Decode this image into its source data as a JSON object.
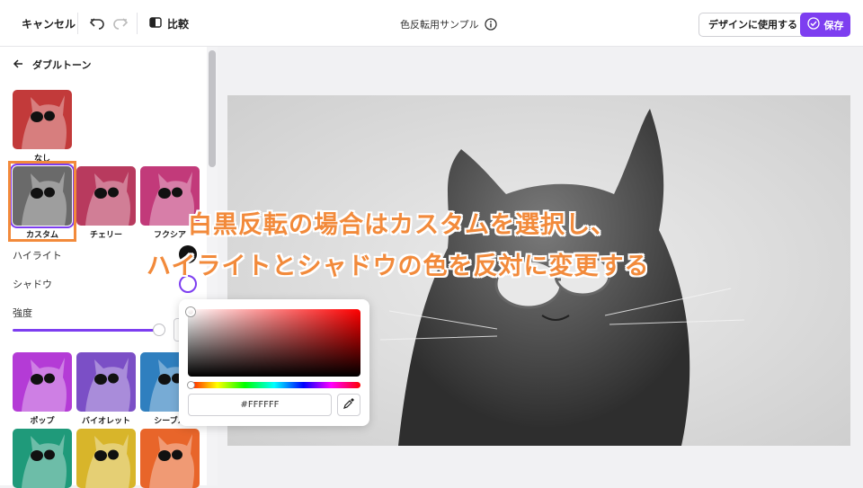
{
  "toolbar": {
    "cancel_label": "キャンセル",
    "undo_icon": "undo-icon",
    "redo_icon": "redo-icon",
    "compare_label": "比較",
    "compare_icon": "compare-icon",
    "doc_title": "色反転用サンプル",
    "info_icon": "info-icon",
    "use_in_design_label": "デザインに使用する",
    "save_label": "保存",
    "save_icon": "check-circle-icon",
    "accent_color": "#7d3ef0"
  },
  "sidebar": {
    "back_icon": "arrow-left-icon",
    "section_title": "ダブルトーン",
    "presets": [
      {
        "label": "なし",
        "tint": "#c23a3a"
      },
      {
        "label": "カスタム",
        "tint": "#6a6a6a",
        "selected": true
      },
      {
        "label": "チェリー",
        "tint": "#b83a5e"
      },
      {
        "label": "フクシア",
        "tint": "#c23a7a"
      },
      {
        "label": "ポップ",
        "tint": "#b43bd6"
      },
      {
        "label": "バイオレット",
        "tint": "#7b4fc6"
      },
      {
        "label": "シーブル",
        "tint": "#2f7fbf"
      },
      {
        "label": "",
        "tint": "#1f9a7a"
      },
      {
        "label": "",
        "tint": "#d8b52a"
      },
      {
        "label": "",
        "tint": "#e8652a"
      }
    ],
    "highlight_label": "ハイライト",
    "shadow_label": "シャドウ",
    "highlight_color": "#111111",
    "shadow_color": "#7d3ef0",
    "intensity_label": "強度",
    "intensity_value": 0.97
  },
  "color_picker": {
    "hex_value": "#FFFFFF",
    "eyedropper_icon": "eyedropper-icon"
  },
  "annotation": {
    "line1": "白黒反転の場合はカスタムを選択し、",
    "line2": "ハイライトとシャドウの色を反対に変更する",
    "color": "#f28a3b"
  }
}
